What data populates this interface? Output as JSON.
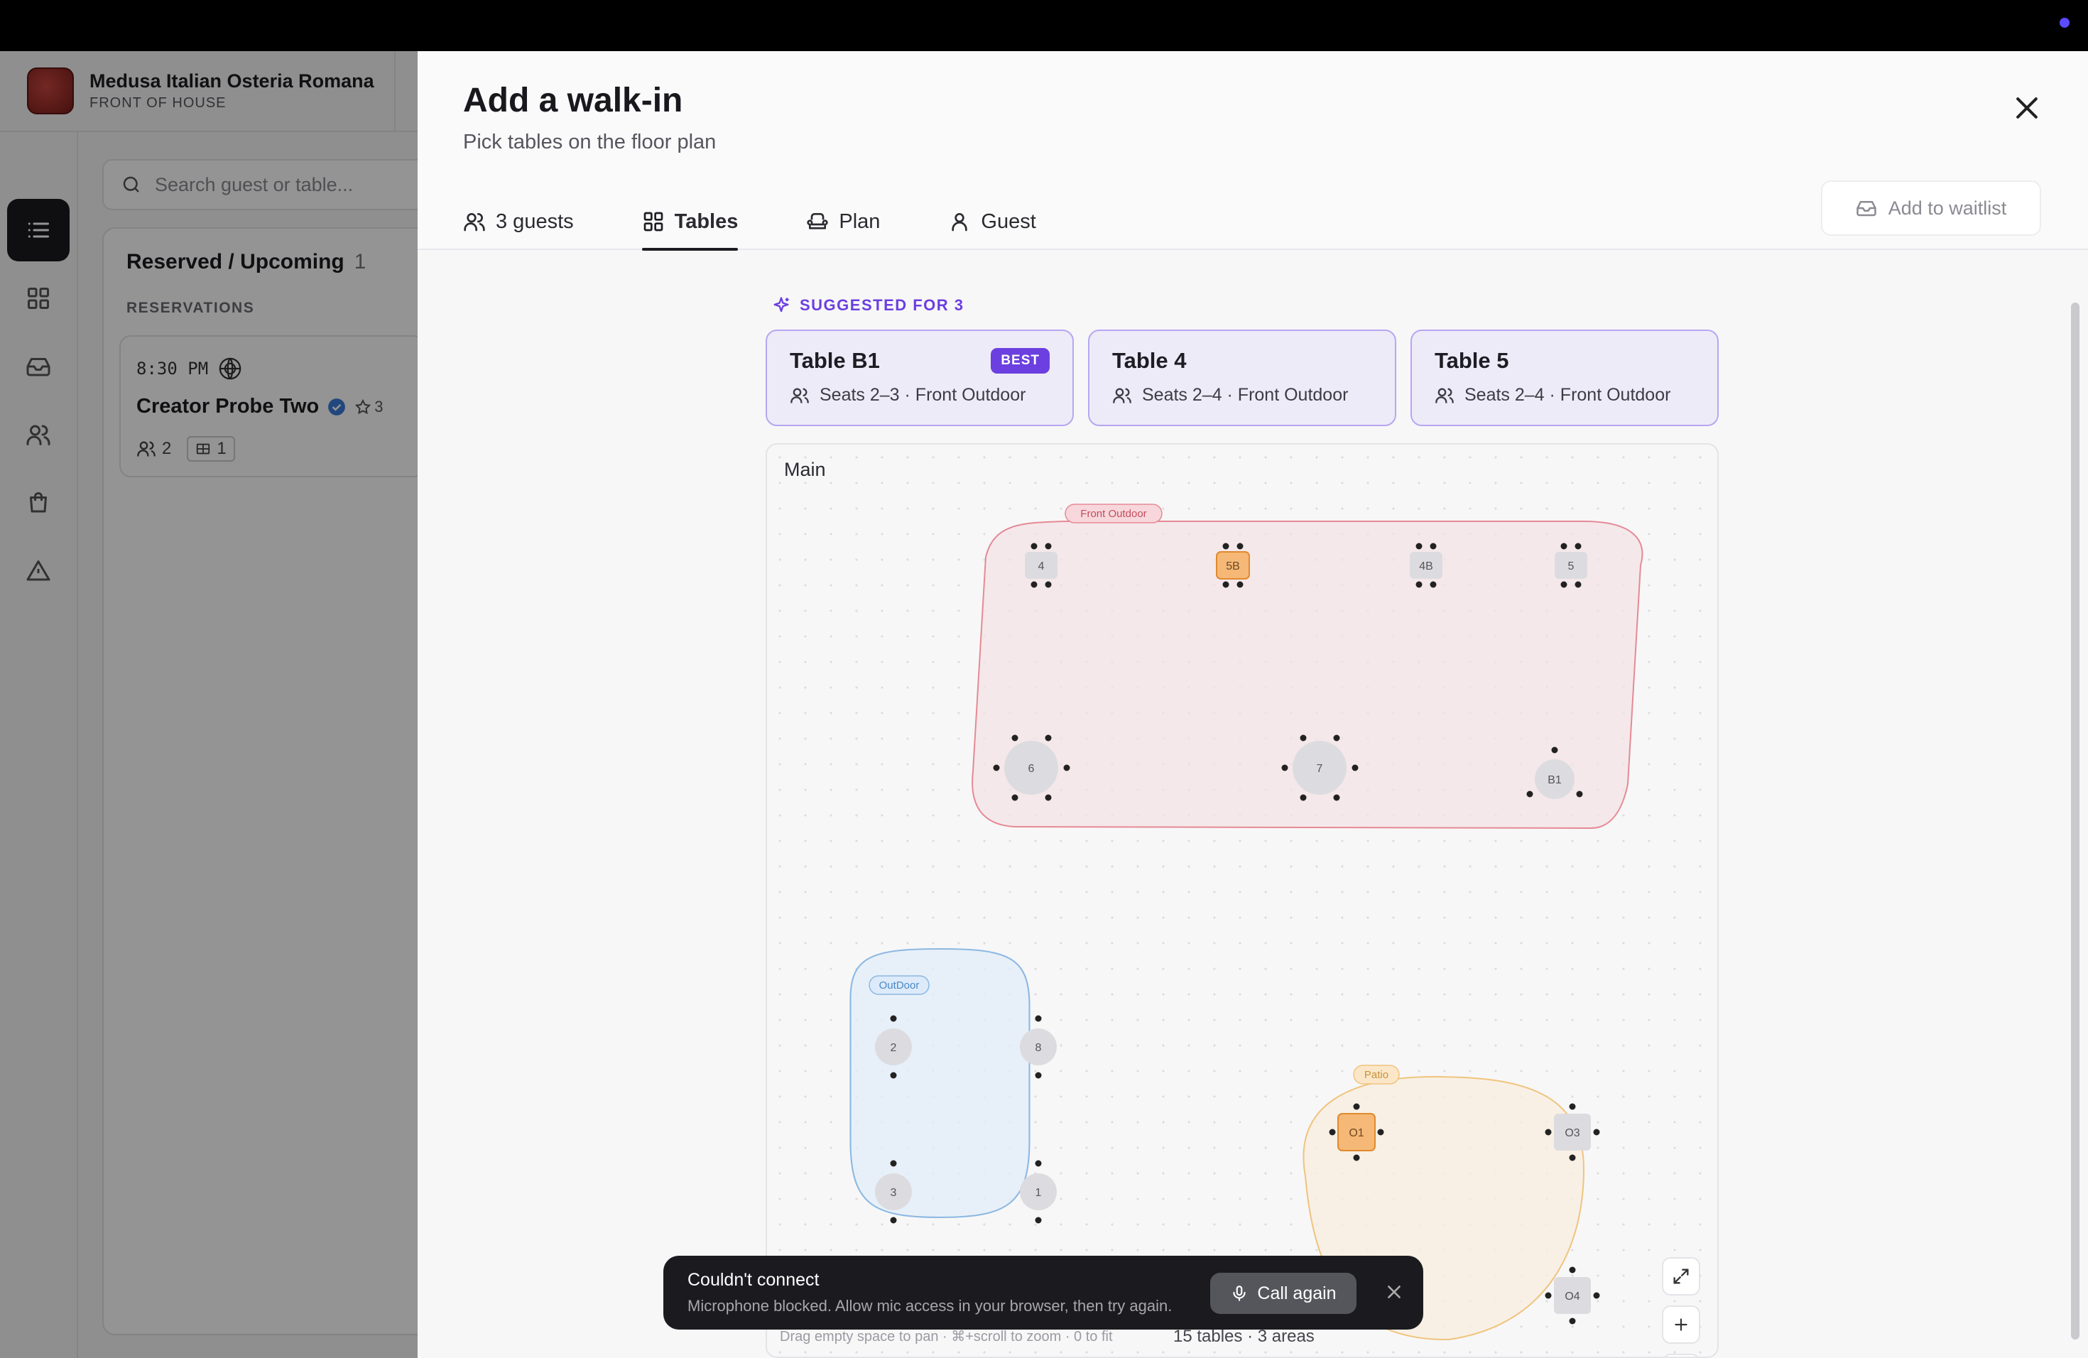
{
  "brand": {
    "name": "Medusa Italian Osteria Romana",
    "subtitle": "FRONT OF HOUSE"
  },
  "search": {
    "placeholder": "Search guest or table..."
  },
  "list": {
    "title": "Reserved / Upcoming",
    "count": "1",
    "section": "RESERVATIONS",
    "reservation": {
      "time": "8:30 PM",
      "name": "Creator Probe Two",
      "stars": "3",
      "party": "2",
      "tables": "1"
    }
  },
  "modal": {
    "title": "Add a walk-in",
    "subtitle": "Pick tables on the floor plan",
    "tabs": [
      {
        "label": "3 guests",
        "icon": "users-icon"
      },
      {
        "label": "Tables",
        "icon": "grid-icon"
      },
      {
        "label": "Plan",
        "icon": "armchair-icon"
      },
      {
        "label": "Guest",
        "icon": "user-icon"
      }
    ],
    "active_tab": "Tables",
    "waitlist_label": "Add to waitlist"
  },
  "suggestions": {
    "label": "SUGGESTED FOR 3",
    "cards": [
      {
        "name": "Table B1",
        "detail": "Seats 2–3 · Front Outdoor",
        "badge": "BEST"
      },
      {
        "name": "Table 4",
        "detail": "Seats 2–4 · Front Outdoor"
      },
      {
        "name": "Table 5",
        "detail": "Seats 2–4 · Front Outdoor"
      }
    ]
  },
  "floor": {
    "title": "Main",
    "areas": [
      {
        "name": "Front Outdoor",
        "color": "#e58a95"
      },
      {
        "name": "OutDoor",
        "color": "#8cb8e2"
      },
      {
        "name": "Patio",
        "color": "#f0c47e"
      }
    ],
    "tables": {
      "t4": "4",
      "t5b": "5B",
      "t4b": "4B",
      "t5": "5",
      "t6": "6",
      "t7": "7",
      "tb1": "B1",
      "t2": "2",
      "t8": "8",
      "t3": "3",
      "t1": "1",
      "to1": "O1",
      "to3": "O3",
      "to4": "O4"
    },
    "hint": "Drag empty space to pan · ⌘+scroll to zoom · 0 to fit",
    "summary": "15 tables · 3 areas"
  },
  "toast": {
    "title": "Couldn't connect",
    "message": "Microphone blocked. Allow mic access in your browser, then try again.",
    "action": "Call again"
  },
  "colors": {
    "accent": "#6b3fe0",
    "selected_table": "#f5b877"
  }
}
